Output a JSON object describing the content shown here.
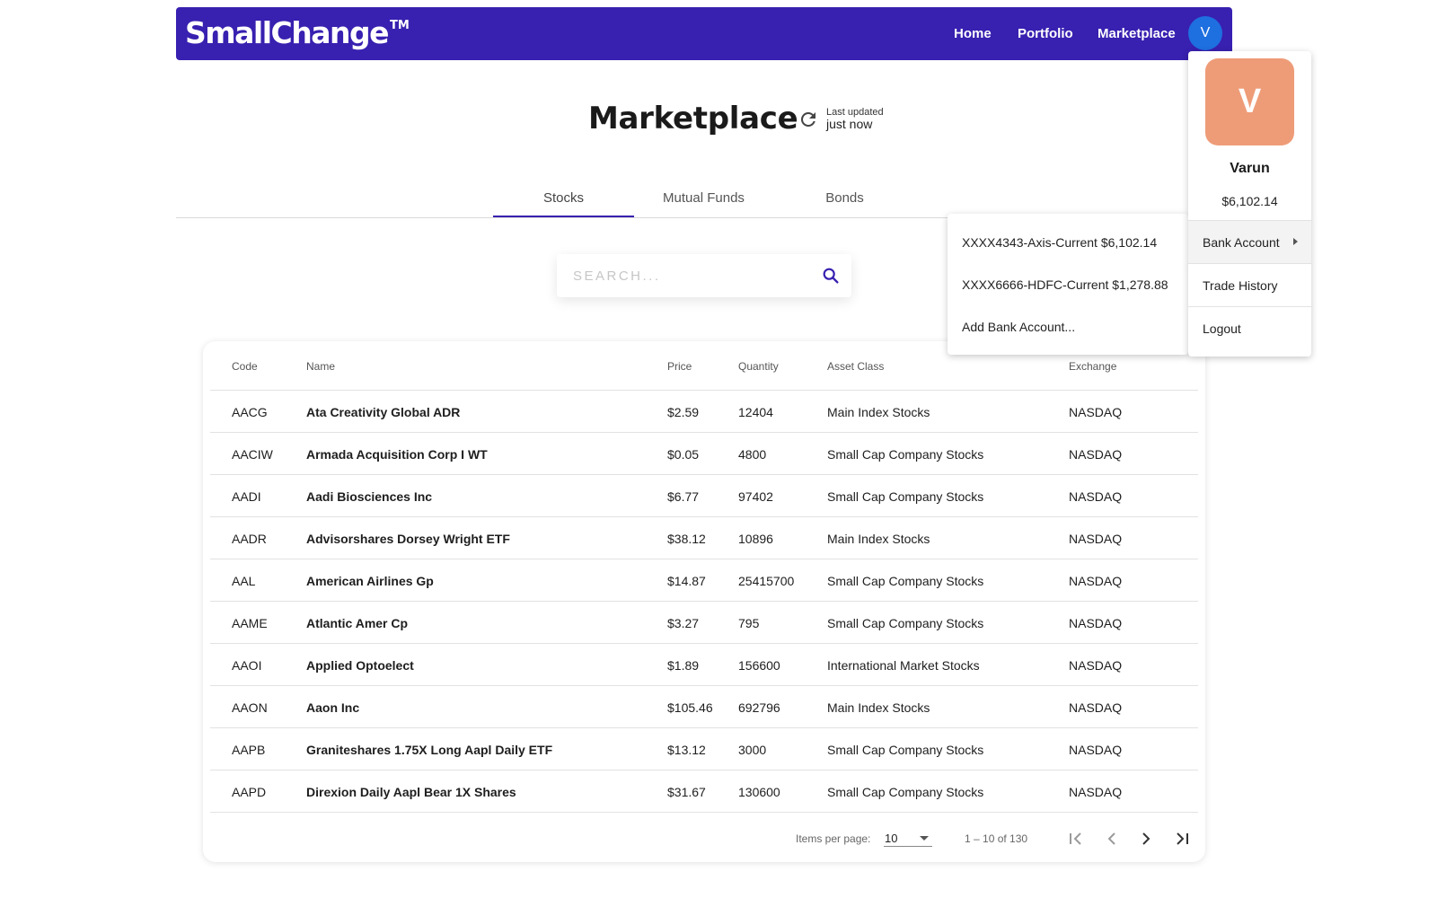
{
  "navbar": {
    "brand": "SmallChange",
    "brand_tm": "TM",
    "links": [
      "Home",
      "Portfolio",
      "Marketplace"
    ],
    "avatar_initial": "V",
    "color": "#3820b0"
  },
  "header": {
    "title": "Marketplace",
    "last_updated_label": "Last updated",
    "last_updated_value": "just now",
    "refresh_icon": "refresh-icon"
  },
  "tabs": [
    {
      "label": "Stocks",
      "active": true
    },
    {
      "label": "Mutual Funds",
      "active": false
    },
    {
      "label": "Bonds",
      "active": false
    }
  ],
  "search": {
    "placeholder": "SEARCH...",
    "value": "",
    "icon": "search-icon"
  },
  "table": {
    "columns": [
      "Code",
      "Name",
      "Price",
      "Quantity",
      "Asset Class",
      "Exchange"
    ],
    "rows": [
      [
        "AACG",
        "Ata Creativity Global ADR",
        "$2.59",
        "12404",
        "Main Index Stocks",
        "NASDAQ"
      ],
      [
        "AACIW",
        "Armada Acquisition Corp I WT",
        "$0.05",
        "4800",
        "Small Cap Company Stocks",
        "NASDAQ"
      ],
      [
        "AADI",
        "Aadi Biosciences Inc",
        "$6.77",
        "97402",
        "Small Cap Company Stocks",
        "NASDAQ"
      ],
      [
        "AADR",
        "Advisorshares Dorsey Wright ETF",
        "$38.12",
        "10896",
        "Main Index Stocks",
        "NASDAQ"
      ],
      [
        "AAL",
        "American Airlines Gp",
        "$14.87",
        "25415700",
        "Small Cap Company Stocks",
        "NASDAQ"
      ],
      [
        "AAME",
        "Atlantic Amer Cp",
        "$3.27",
        "795",
        "Small Cap Company Stocks",
        "NASDAQ"
      ],
      [
        "AAOI",
        "Applied Optoelect",
        "$1.89",
        "156600",
        "International Market Stocks",
        "NASDAQ"
      ],
      [
        "AAON",
        "Aaon Inc",
        "$105.46",
        "692796",
        "Main Index Stocks",
        "NASDAQ"
      ],
      [
        "AAPB",
        "Graniteshares 1.75X Long Aapl Daily ETF",
        "$13.12",
        "3000",
        "Small Cap Company Stocks",
        "NASDAQ"
      ],
      [
        "AAPD",
        "Direxion Daily Aapl Bear 1X Shares",
        "$31.67",
        "130600",
        "Small Cap Company Stocks",
        "NASDAQ"
      ]
    ]
  },
  "paginator": {
    "items_per_page_label": "Items per page:",
    "items_per_page": "10",
    "range_label": "1 – 10 of 130"
  },
  "profile_menu": {
    "avatar_initial": "V",
    "avatar_color": "#ee9c78",
    "name": "Varun",
    "balance": "$6,102.14",
    "items": [
      "Bank Account",
      "Trade History",
      "Logout"
    ]
  },
  "bank_menu": {
    "items": [
      "XXXX4343-Axis-Current $6,102.14",
      "XXXX6666-HDFC-Current $1,278.88",
      "Add Bank Account..."
    ]
  }
}
